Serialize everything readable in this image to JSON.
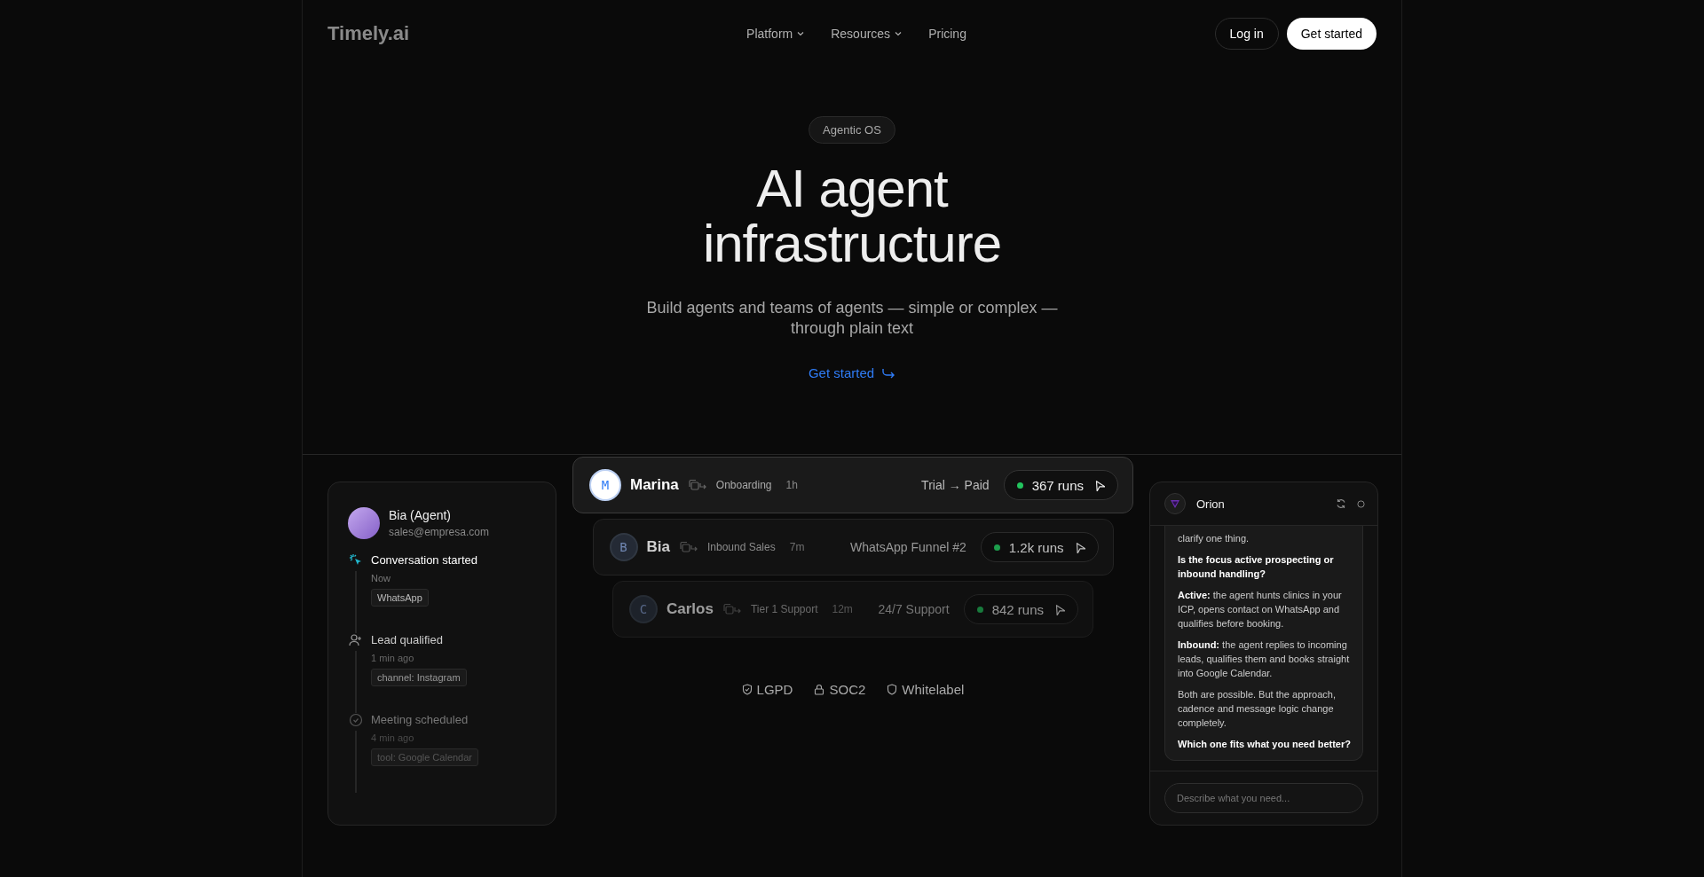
{
  "header": {
    "logo": "Timely.ai",
    "nav": [
      {
        "label": "Platform",
        "has_menu": true
      },
      {
        "label": "Resources",
        "has_menu": true
      },
      {
        "label": "Pricing",
        "has_menu": false
      }
    ],
    "login": "Log in",
    "cta": "Get started"
  },
  "hero": {
    "badge": "Agentic OS",
    "title_lines": [
      "AI agent",
      "infrastructure"
    ],
    "subtitle_lines": [
      "Build agents and teams of agents — simple or complex —",
      "through plain text"
    ],
    "link": "Get started"
  },
  "activity": {
    "agent_name": "Bia (Agent)",
    "agent_email": "sales@empresa.com",
    "steps": [
      {
        "kind": "started",
        "active": true,
        "muted": false,
        "title": "Conversation started",
        "time": "Now",
        "tag": "WhatsApp"
      },
      {
        "kind": "qualified",
        "active": false,
        "muted": false,
        "title": "Lead qualified",
        "time": "1 min ago",
        "tag": "channel: Instagram"
      },
      {
        "kind": "scheduled",
        "active": false,
        "muted": true,
        "title": "Meeting scheduled",
        "time": "4 min ago",
        "tag": "tool: Google Calendar"
      }
    ]
  },
  "agents": [
    {
      "kind": "front",
      "initial": "M",
      "name": "Marina",
      "team": "Onboarding",
      "age": "1h",
      "flow": "Trial → Paid",
      "runs": "367 runs"
    },
    {
      "kind": "middle",
      "initial": "B",
      "name": "Bia",
      "team": "Inbound Sales",
      "age": "7m",
      "flow": "WhatsApp Funnel #2",
      "runs": "1.2k runs"
    },
    {
      "kind": "back",
      "initial": "C",
      "name": "Carlos",
      "team": "Tier 1 Support",
      "age": "12m",
      "flow": "24/7 Support",
      "runs": "842 runs"
    }
  ],
  "trust": [
    {
      "kind": "shield-check",
      "label": "LGPD"
    },
    {
      "kind": "lock",
      "label": "SOC2"
    },
    {
      "kind": "shield",
      "label": "Whitelabel"
    }
  ],
  "chat": {
    "name": "Orion",
    "paragraphs": [
      {
        "kind": "plain",
        "text": "clarify one thing."
      },
      {
        "kind": "bold",
        "text": "Is the focus active prospecting or inbound handling?"
      },
      {
        "kind": "plain",
        "text": "**Active:** the agent hunts clinics in your ICP, opens contact on WhatsApp and qualifies before booking."
      },
      {
        "kind": "plain",
        "text": "**Inbound:** the agent replies to incoming leads, qualifies them and books straight into Google Calendar."
      },
      {
        "kind": "plain",
        "text": "Both are possible. But the approach, cadence and message logic change completely."
      },
      {
        "kind": "bold",
        "text": "Which one fits what you need better?"
      }
    ],
    "placeholder": "Describe what you need..."
  }
}
